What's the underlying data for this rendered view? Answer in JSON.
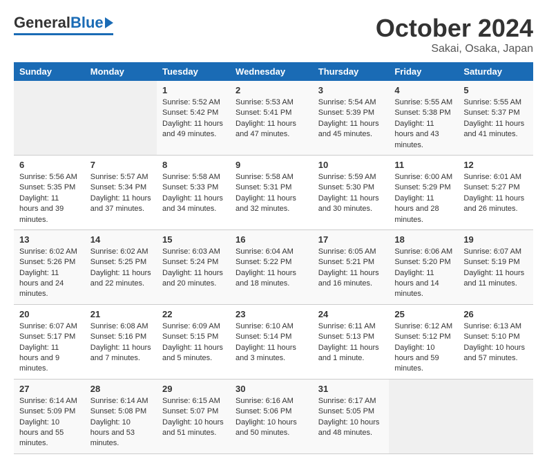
{
  "header": {
    "logo_general": "General",
    "logo_blue": "Blue",
    "month_title": "October 2024",
    "location": "Sakai, Osaka, Japan"
  },
  "weekdays": [
    "Sunday",
    "Monday",
    "Tuesday",
    "Wednesday",
    "Thursday",
    "Friday",
    "Saturday"
  ],
  "weeks": [
    [
      {
        "day": "",
        "info": ""
      },
      {
        "day": "",
        "info": ""
      },
      {
        "day": "1",
        "sunrise": "Sunrise: 5:52 AM",
        "sunset": "Sunset: 5:42 PM",
        "daylight": "Daylight: 11 hours and 49 minutes."
      },
      {
        "day": "2",
        "sunrise": "Sunrise: 5:53 AM",
        "sunset": "Sunset: 5:41 PM",
        "daylight": "Daylight: 11 hours and 47 minutes."
      },
      {
        "day": "3",
        "sunrise": "Sunrise: 5:54 AM",
        "sunset": "Sunset: 5:39 PM",
        "daylight": "Daylight: 11 hours and 45 minutes."
      },
      {
        "day": "4",
        "sunrise": "Sunrise: 5:55 AM",
        "sunset": "Sunset: 5:38 PM",
        "daylight": "Daylight: 11 hours and 43 minutes."
      },
      {
        "day": "5",
        "sunrise": "Sunrise: 5:55 AM",
        "sunset": "Sunset: 5:37 PM",
        "daylight": "Daylight: 11 hours and 41 minutes."
      }
    ],
    [
      {
        "day": "6",
        "sunrise": "Sunrise: 5:56 AM",
        "sunset": "Sunset: 5:35 PM",
        "daylight": "Daylight: 11 hours and 39 minutes."
      },
      {
        "day": "7",
        "sunrise": "Sunrise: 5:57 AM",
        "sunset": "Sunset: 5:34 PM",
        "daylight": "Daylight: 11 hours and 37 minutes."
      },
      {
        "day": "8",
        "sunrise": "Sunrise: 5:58 AM",
        "sunset": "Sunset: 5:33 PM",
        "daylight": "Daylight: 11 hours and 34 minutes."
      },
      {
        "day": "9",
        "sunrise": "Sunrise: 5:58 AM",
        "sunset": "Sunset: 5:31 PM",
        "daylight": "Daylight: 11 hours and 32 minutes."
      },
      {
        "day": "10",
        "sunrise": "Sunrise: 5:59 AM",
        "sunset": "Sunset: 5:30 PM",
        "daylight": "Daylight: 11 hours and 30 minutes."
      },
      {
        "day": "11",
        "sunrise": "Sunrise: 6:00 AM",
        "sunset": "Sunset: 5:29 PM",
        "daylight": "Daylight: 11 hours and 28 minutes."
      },
      {
        "day": "12",
        "sunrise": "Sunrise: 6:01 AM",
        "sunset": "Sunset: 5:27 PM",
        "daylight": "Daylight: 11 hours and 26 minutes."
      }
    ],
    [
      {
        "day": "13",
        "sunrise": "Sunrise: 6:02 AM",
        "sunset": "Sunset: 5:26 PM",
        "daylight": "Daylight: 11 hours and 24 minutes."
      },
      {
        "day": "14",
        "sunrise": "Sunrise: 6:02 AM",
        "sunset": "Sunset: 5:25 PM",
        "daylight": "Daylight: 11 hours and 22 minutes."
      },
      {
        "day": "15",
        "sunrise": "Sunrise: 6:03 AM",
        "sunset": "Sunset: 5:24 PM",
        "daylight": "Daylight: 11 hours and 20 minutes."
      },
      {
        "day": "16",
        "sunrise": "Sunrise: 6:04 AM",
        "sunset": "Sunset: 5:22 PM",
        "daylight": "Daylight: 11 hours and 18 minutes."
      },
      {
        "day": "17",
        "sunrise": "Sunrise: 6:05 AM",
        "sunset": "Sunset: 5:21 PM",
        "daylight": "Daylight: 11 hours and 16 minutes."
      },
      {
        "day": "18",
        "sunrise": "Sunrise: 6:06 AM",
        "sunset": "Sunset: 5:20 PM",
        "daylight": "Daylight: 11 hours and 14 minutes."
      },
      {
        "day": "19",
        "sunrise": "Sunrise: 6:07 AM",
        "sunset": "Sunset: 5:19 PM",
        "daylight": "Daylight: 11 hours and 11 minutes."
      }
    ],
    [
      {
        "day": "20",
        "sunrise": "Sunrise: 6:07 AM",
        "sunset": "Sunset: 5:17 PM",
        "daylight": "Daylight: 11 hours and 9 minutes."
      },
      {
        "day": "21",
        "sunrise": "Sunrise: 6:08 AM",
        "sunset": "Sunset: 5:16 PM",
        "daylight": "Daylight: 11 hours and 7 minutes."
      },
      {
        "day": "22",
        "sunrise": "Sunrise: 6:09 AM",
        "sunset": "Sunset: 5:15 PM",
        "daylight": "Daylight: 11 hours and 5 minutes."
      },
      {
        "day": "23",
        "sunrise": "Sunrise: 6:10 AM",
        "sunset": "Sunset: 5:14 PM",
        "daylight": "Daylight: 11 hours and 3 minutes."
      },
      {
        "day": "24",
        "sunrise": "Sunrise: 6:11 AM",
        "sunset": "Sunset: 5:13 PM",
        "daylight": "Daylight: 11 hours and 1 minute."
      },
      {
        "day": "25",
        "sunrise": "Sunrise: 6:12 AM",
        "sunset": "Sunset: 5:12 PM",
        "daylight": "Daylight: 10 hours and 59 minutes."
      },
      {
        "day": "26",
        "sunrise": "Sunrise: 6:13 AM",
        "sunset": "Sunset: 5:10 PM",
        "daylight": "Daylight: 10 hours and 57 minutes."
      }
    ],
    [
      {
        "day": "27",
        "sunrise": "Sunrise: 6:14 AM",
        "sunset": "Sunset: 5:09 PM",
        "daylight": "Daylight: 10 hours and 55 minutes."
      },
      {
        "day": "28",
        "sunrise": "Sunrise: 6:14 AM",
        "sunset": "Sunset: 5:08 PM",
        "daylight": "Daylight: 10 hours and 53 minutes."
      },
      {
        "day": "29",
        "sunrise": "Sunrise: 6:15 AM",
        "sunset": "Sunset: 5:07 PM",
        "daylight": "Daylight: 10 hours and 51 minutes."
      },
      {
        "day": "30",
        "sunrise": "Sunrise: 6:16 AM",
        "sunset": "Sunset: 5:06 PM",
        "daylight": "Daylight: 10 hours and 50 minutes."
      },
      {
        "day": "31",
        "sunrise": "Sunrise: 6:17 AM",
        "sunset": "Sunset: 5:05 PM",
        "daylight": "Daylight: 10 hours and 48 minutes."
      },
      {
        "day": "",
        "info": ""
      },
      {
        "day": "",
        "info": ""
      }
    ]
  ]
}
